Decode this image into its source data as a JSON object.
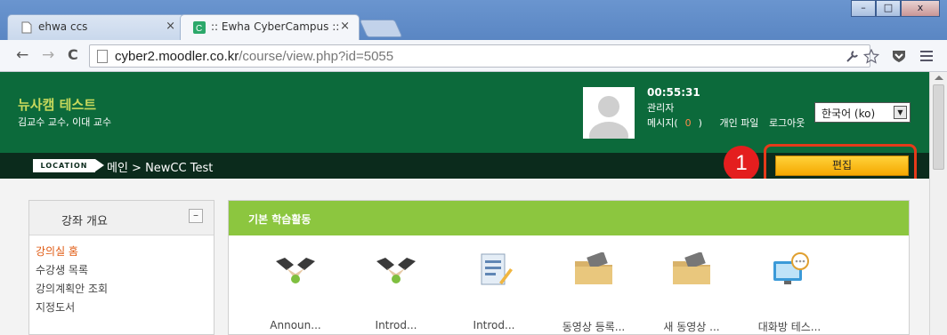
{
  "browser": {
    "tabs": [
      {
        "label": "ehwa ccs",
        "close": "×"
      },
      {
        "label": ":: Ewha CyberCampus ::",
        "close": "×"
      }
    ],
    "window_buttons": {
      "minimize": "–",
      "maximize": "□",
      "close": "x"
    },
    "nav": {
      "back": "←",
      "forward": "→",
      "reload": "C"
    },
    "url": {
      "host": "cyber2.moodler.co.kr",
      "path": "/course/view.php?id=5055"
    },
    "toolbar_icons": [
      "wrench-icon",
      "star-icon",
      "shield-icon",
      "menu-icon"
    ]
  },
  "header": {
    "site_title": "뉴사캠 테스트",
    "site_subtitle": "김교수 교수, 이대 교수",
    "time": "00:55:31",
    "role": "관리자",
    "links": {
      "message": "메시지(",
      "message_count": "0",
      "message_close": ")",
      "profile": "개인 파일",
      "logout": "로그아웃"
    },
    "language": "한국어 (ko)"
  },
  "location": {
    "badge": "LOCATION",
    "breadcrumb": "메인 > NewCC Test",
    "callout_number": "1",
    "edit_button": "편집"
  },
  "sidebar": {
    "title": "강좌 개요",
    "collapse": "–",
    "items": [
      "강의실 홈",
      "수강생 목록",
      "강의계획안 조회",
      "지정도서"
    ],
    "active_index": 0
  },
  "main": {
    "section_title": "기본 학습활동",
    "activities": [
      {
        "label": "Announ...",
        "icon": "handshake-icon"
      },
      {
        "label": "Introd...",
        "icon": "handshake-icon"
      },
      {
        "label": "Introd...",
        "icon": "document-edit-icon"
      },
      {
        "label": "동영상 등록...",
        "icon": "video-folder-icon"
      },
      {
        "label": "새 동영상 ...",
        "icon": "video-folder-icon"
      },
      {
        "label": "대화방 테스...",
        "icon": "chat-monitor-icon"
      }
    ]
  },
  "colors": {
    "header_green": "#0c6a3b",
    "location_bar": "#0b2b1c",
    "section_green": "#8cc63f",
    "edit_button": "#f5a800",
    "active_link": "#e05a12",
    "callout_red": "#e41e1e"
  }
}
